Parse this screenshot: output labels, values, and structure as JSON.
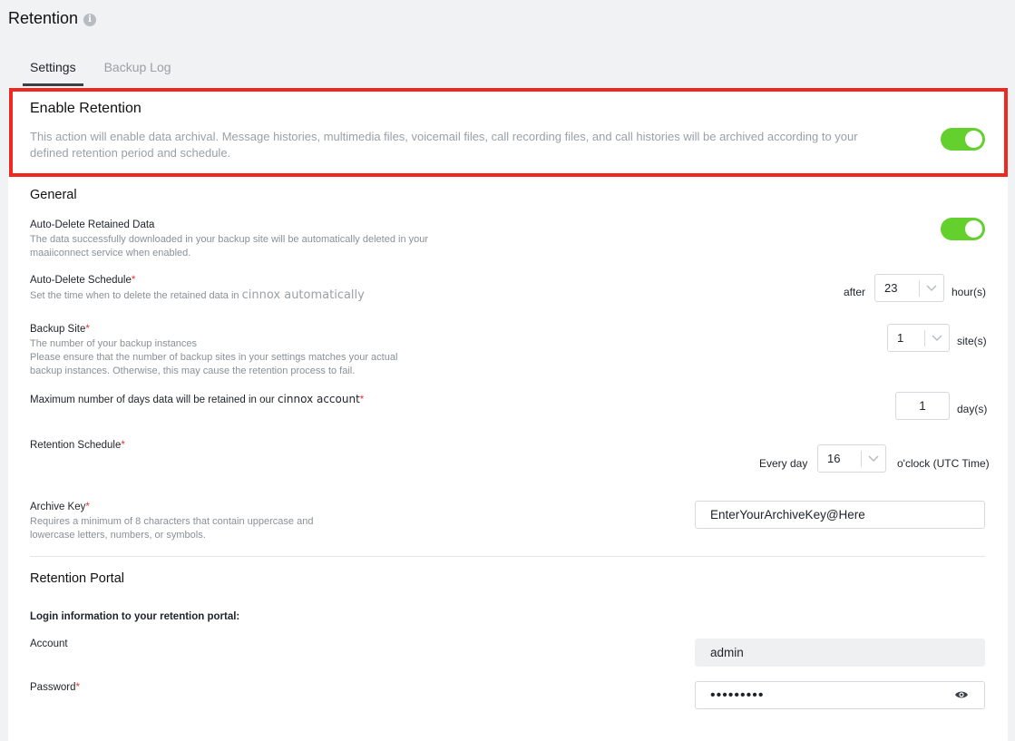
{
  "header": {
    "title": "Retention"
  },
  "tabs": [
    {
      "label": "Settings",
      "active": true
    },
    {
      "label": "Backup Log",
      "active": false
    }
  ],
  "enable_retention": {
    "title": "Enable Retention",
    "description_line1": "This action will enable data archival. Message histories, multimedia files, voicemail files, call recording files, and call histories will be archived according to your",
    "description_line2": "defined retention period and schedule.",
    "enabled": true
  },
  "general": {
    "title": "General",
    "auto_delete": {
      "label": "Auto-Delete Retained Data",
      "desc_line1": "The data successfully downloaded in your backup site will be automatically deleted in your",
      "desc_line2": "maaiiconnect service when enabled.",
      "enabled": true
    },
    "auto_delete_schedule": {
      "label": "Auto-Delete Schedule",
      "desc": "Set the time when to delete the retained data in",
      "desc_overlay": "cinnox automatically",
      "prefix": "after",
      "value": "23",
      "unit": "hour(s)"
    },
    "backup_site": {
      "label": "Backup Site",
      "desc_line1": "The number of your backup instances",
      "desc_line2": "Please ensure that the number of backup sites in your settings matches your actual",
      "desc_line3": "backup instances. Otherwise, this may cause the retention process to fail.",
      "value": "1",
      "unit": "site(s)"
    },
    "max_days": {
      "label": "Maximum number of days data will be retained in our",
      "label_overlay": "cinnox account",
      "value": "1",
      "unit": "day(s)"
    },
    "retention_schedule": {
      "label": "Retention Schedule",
      "prefix": "Every day",
      "value": "16",
      "unit": "o'clock (UTC Time)"
    },
    "archive_key": {
      "label": "Archive Key",
      "desc_line1": "Requires a minimum of 8 characters that contain uppercase and",
      "desc_line2": "lowercase letters, numbers, or symbols.",
      "value": "EnterYourArchiveKey@Here"
    }
  },
  "portal": {
    "title": "Retention Portal",
    "login_info": "Login information to your retention portal:",
    "account_label": "Account",
    "account_value": "admin",
    "password_label": "Password",
    "password_value": "•••••••••"
  },
  "icons": {
    "info": "info-icon",
    "chevron": "chevron-down-icon",
    "eye": "eye-icon"
  },
  "colors": {
    "accent_green": "#64d02e",
    "highlight_red": "#f0281f",
    "required_red": "#e53935"
  }
}
